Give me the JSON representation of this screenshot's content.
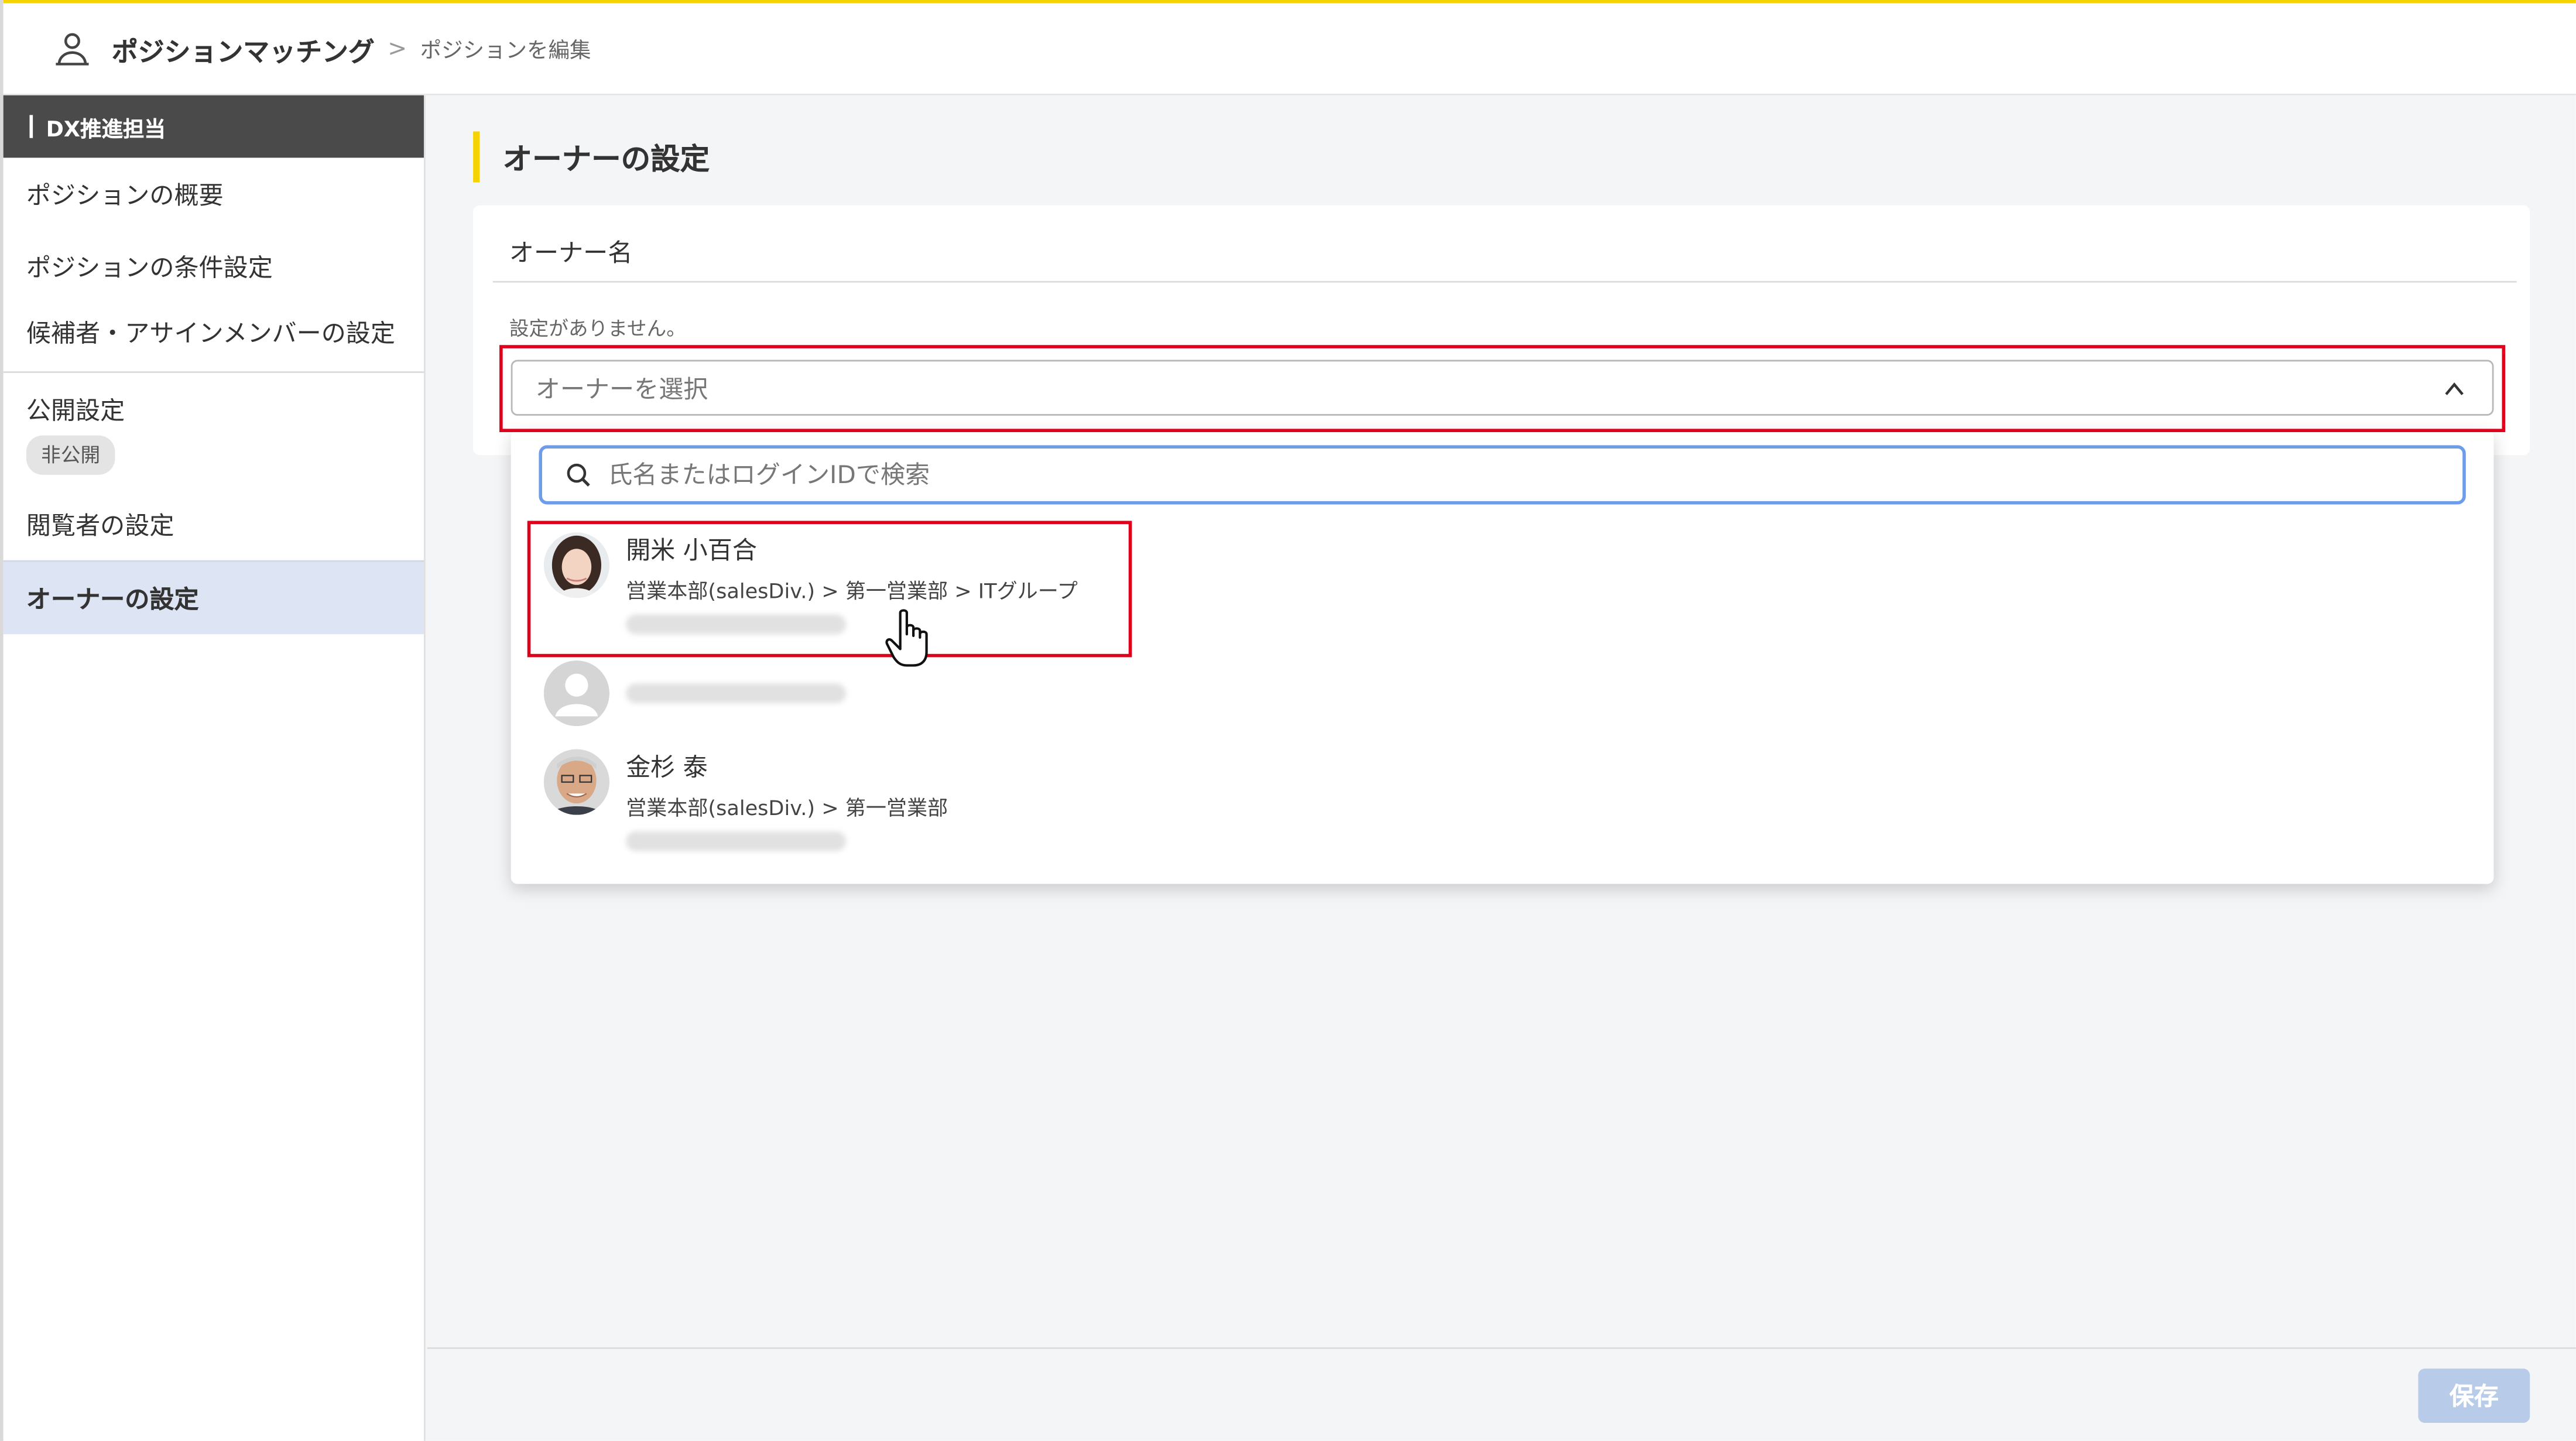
{
  "header": {
    "app_title": "ポジションマッチング",
    "breadcrumb_separator": ">",
    "breadcrumb_current": "ポジションを編集",
    "app_icon": "person-icon"
  },
  "sidebar": {
    "position_name": "DX推進担当",
    "items": [
      {
        "label": "ポジションの概要"
      },
      {
        "label": "ポジションの条件設定"
      },
      {
        "label": "候補者・アサインメンバーの設定"
      },
      {
        "label": "公開設定",
        "badge": "非公開"
      },
      {
        "label": "閲覧者の設定"
      },
      {
        "label": "オーナーの設定",
        "active": true
      }
    ]
  },
  "main": {
    "section_title": "オーナーの設定",
    "card_label": "オーナー名",
    "empty_text": "設定がありません。",
    "select_placeholder": "オーナーを選択",
    "search_placeholder": "氏名またはログインIDで検索",
    "users": [
      {
        "name": "開米 小百合",
        "dept": "営業本部(salesDiv.) > 第一営業部 > ITグループ"
      },
      {
        "name": "",
        "dept": ""
      },
      {
        "name": "金杉 泰",
        "dept": "営業本部(salesDiv.) > 第一営業部"
      }
    ]
  },
  "footer": {
    "save_label": "保存"
  },
  "colors": {
    "accent_yellow": "#f5d300",
    "highlight_red": "#e0001b",
    "search_border_blue": "#6d9ce8",
    "active_item_bg": "#dde4f3",
    "save_button_disabled": "#b8ccea",
    "sidebar_header_bg": "#4a4a4a"
  }
}
